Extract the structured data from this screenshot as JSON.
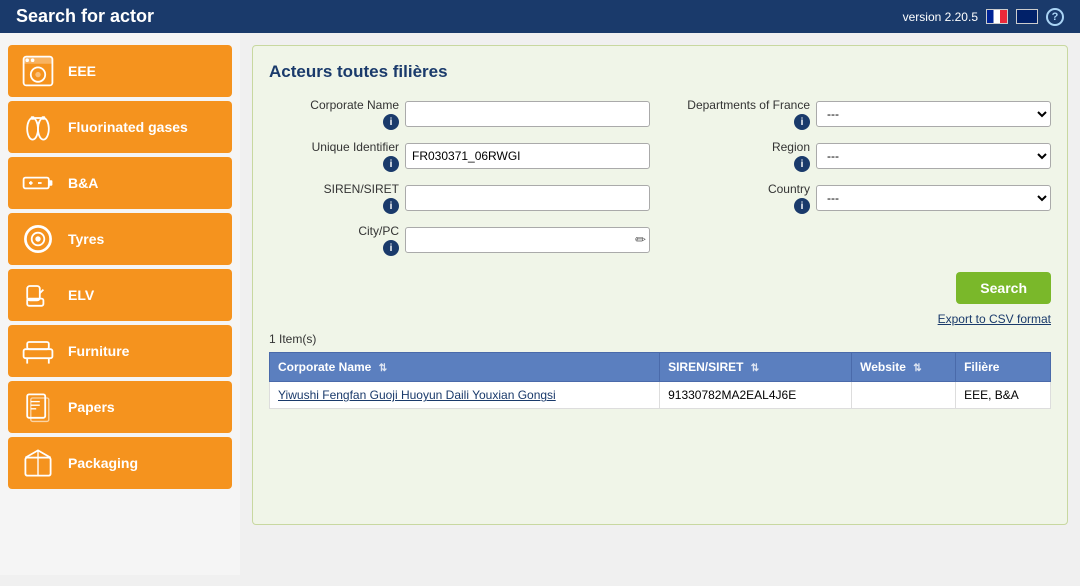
{
  "header": {
    "title": "Search for actor",
    "version": "version 2.20.5",
    "lang_fr": "FR",
    "lang_uk": "UK",
    "help_label": "?"
  },
  "sidebar": {
    "items": [
      {
        "id": "eee",
        "label": "EEE",
        "icon": "washing-machine"
      },
      {
        "id": "fluorinated-gases",
        "label": "Fluorinated gases",
        "icon": "gas-tank"
      },
      {
        "id": "bna",
        "label": "B&A",
        "icon": "battery"
      },
      {
        "id": "tyres",
        "label": "Tyres",
        "icon": "tyre"
      },
      {
        "id": "elv",
        "label": "ELV",
        "icon": "car-seat"
      },
      {
        "id": "furniture",
        "label": "Furniture",
        "icon": "furniture"
      },
      {
        "id": "papers",
        "label": "Papers",
        "icon": "papers"
      },
      {
        "id": "packaging",
        "label": "Packaging",
        "icon": "packaging"
      }
    ]
  },
  "panel": {
    "title": "Acteurs toutes filières",
    "form": {
      "corporate_name_label": "Corporate Name",
      "unique_identifier_label": "Unique Identifier",
      "siren_siret_label": "SIREN/SIRET",
      "city_pc_label": "City/PC",
      "departments_label": "Departments of France",
      "region_label": "Region",
      "country_label": "Country",
      "unique_identifier_value": "FR030371_06RWGI",
      "corporate_name_value": "",
      "siren_siret_value": "",
      "city_pc_value": "",
      "departments_default": "---",
      "region_default": "---",
      "country_default": "---",
      "select_options": [
        "---"
      ]
    },
    "search_button": "Search",
    "export_link": "Export to CSV format",
    "results_count": "1 Item(s)",
    "table": {
      "columns": [
        {
          "id": "corporate_name",
          "label": "Corporate Name"
        },
        {
          "id": "siren_siret",
          "label": "SIREN/SIRET"
        },
        {
          "id": "website",
          "label": "Website"
        },
        {
          "id": "filiere",
          "label": "Filière"
        }
      ],
      "rows": [
        {
          "corporate_name": "Yiwushi Fengfan Guoji Huoyun Daili Youxian Gongsi",
          "siren_siret": "91330782MA2EAL4J6E",
          "website": "",
          "filiere": "EEE, B&A"
        }
      ]
    }
  }
}
